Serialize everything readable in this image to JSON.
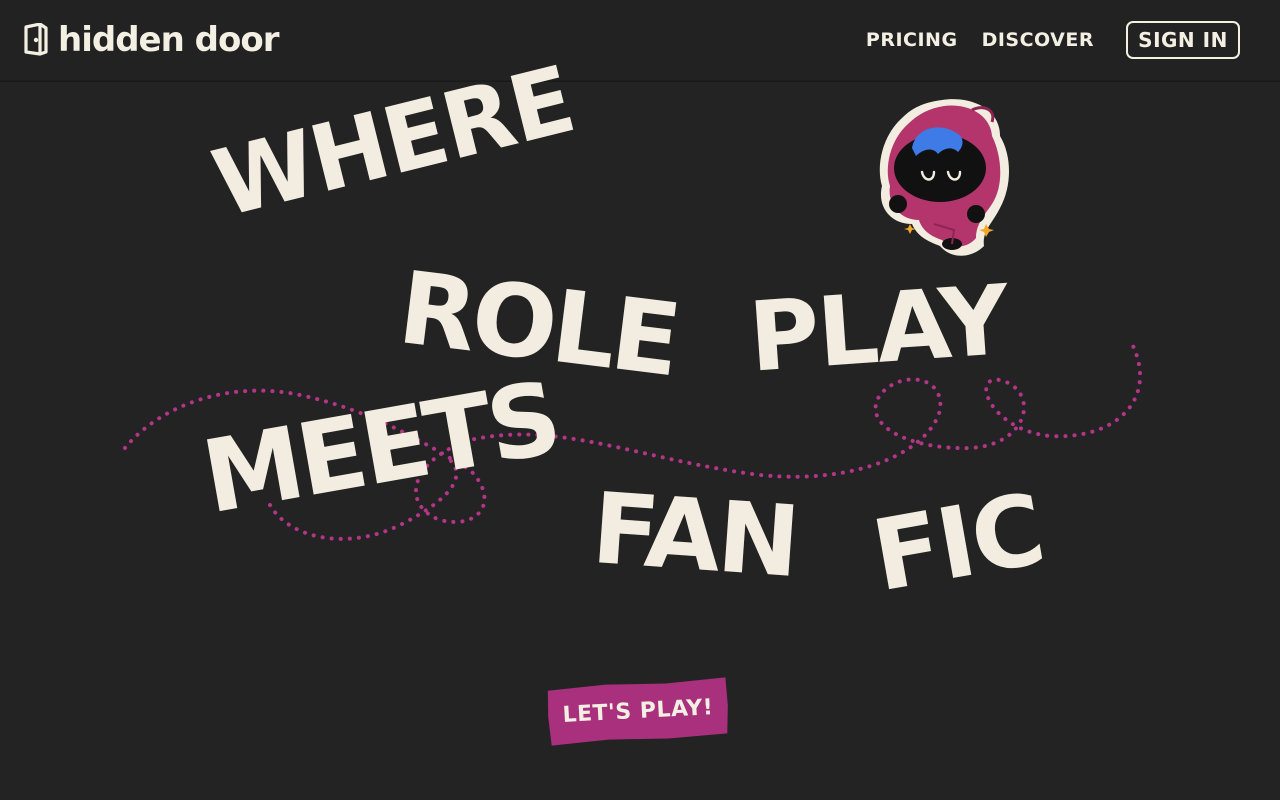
{
  "brand": {
    "name": "hidden door",
    "logo_icon": "hidden-door-logo-icon",
    "text_color": "#f3efe2"
  },
  "nav": {
    "links": [
      {
        "label": "PRICING"
      },
      {
        "label": "DISCOVER"
      }
    ],
    "sign_in_label": "SIGN IN"
  },
  "hero": {
    "words": {
      "where": "WHERE",
      "role": "ROLE",
      "play": "PLAY",
      "meets": "MEETS",
      "fan": "FAN",
      "fic": "FIC"
    },
    "mascot": "hooded-character-mascot",
    "cta_label": "LET'S PLAY!"
  },
  "colors": {
    "background": "#232323",
    "header": "#222222",
    "headline": "#f2ede0",
    "accent": "#a8307c",
    "dotted_path": "#b23587",
    "sparkle": "#f2a62a",
    "mascot_hood": "#b3356c",
    "mascot_hair": "#3e7be6"
  }
}
